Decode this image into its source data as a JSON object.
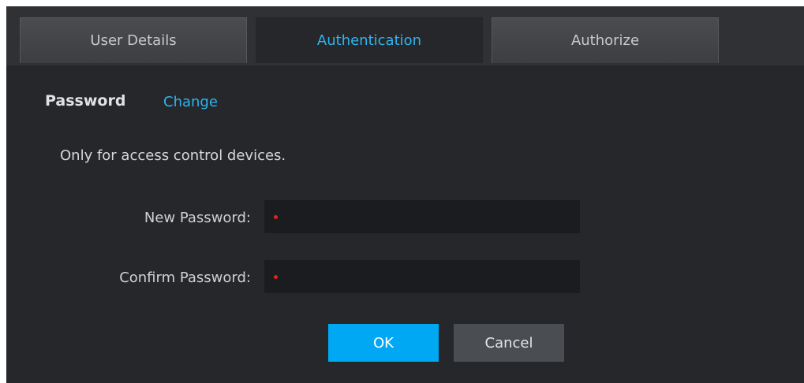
{
  "tabs": [
    {
      "label": "User Details"
    },
    {
      "label": "Authentication"
    },
    {
      "label": "Authorize"
    }
  ],
  "password_section": {
    "title": "Password",
    "change_link": "Change",
    "note": "Only for access control devices."
  },
  "form": {
    "new_password_label": "New Password:",
    "confirm_password_label": "Confirm Password:",
    "new_password_value": "",
    "confirm_password_value": ""
  },
  "buttons": {
    "ok": "OK",
    "cancel": "Cancel"
  },
  "colors": {
    "accent": "#2fb4ef",
    "ok_button": "#00a8f3",
    "required_marker": "#e02323"
  }
}
